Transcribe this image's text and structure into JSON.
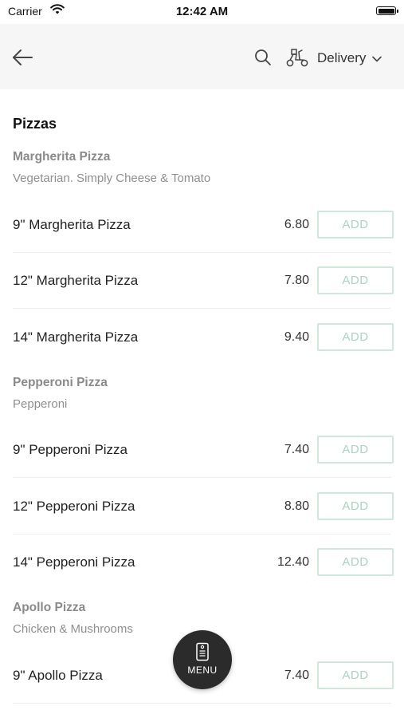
{
  "status_bar": {
    "carrier": "Carrier",
    "time": "12:42 AM",
    "icons": [
      "wifi-icon",
      "battery-icon"
    ]
  },
  "nav": {
    "back_icon": "arrow-left-icon",
    "search_icon": "search-icon",
    "mode_icon": "scooter-icon",
    "mode_label": "Delivery",
    "mode_chevron": "chevron-down-icon"
  },
  "menu": {
    "section_title": "Pizzas",
    "groups": [
      {
        "title": "Margherita Pizza",
        "description": "Vegetarian. Simply Cheese & Tomato",
        "items": [
          {
            "name": "9\" Margherita Pizza",
            "price": "6.80",
            "button": "ADD"
          },
          {
            "name": "12\" Margherita Pizza",
            "price": "7.80",
            "button": "ADD"
          },
          {
            "name": "14\" Margherita Pizza",
            "price": "9.40",
            "button": "ADD"
          }
        ]
      },
      {
        "title": "Pepperoni Pizza",
        "description": "Pepperoni",
        "items": [
          {
            "name": "9\" Pepperoni  Pizza",
            "price": "7.40",
            "button": "ADD"
          },
          {
            "name": "12\" Pepperoni  Pizza",
            "price": "8.80",
            "button": "ADD"
          },
          {
            "name": "14\" Pepperoni  Pizza",
            "price": "12.40",
            "button": "ADD"
          }
        ]
      },
      {
        "title": "Apollo Pizza",
        "description": "Chicken & Mushrooms",
        "items": [
          {
            "name": "9\" Apollo  Pizza",
            "price": "7.40",
            "button": "ADD"
          }
        ]
      }
    ]
  },
  "fab": {
    "label": "MENU",
    "icon": "menu-card-icon"
  },
  "colors": {
    "nav_background": "#f6f6f6",
    "add_border": "#cfe8dc",
    "add_text": "#a6d6bf",
    "fab_background": "#2b2b2b"
  }
}
